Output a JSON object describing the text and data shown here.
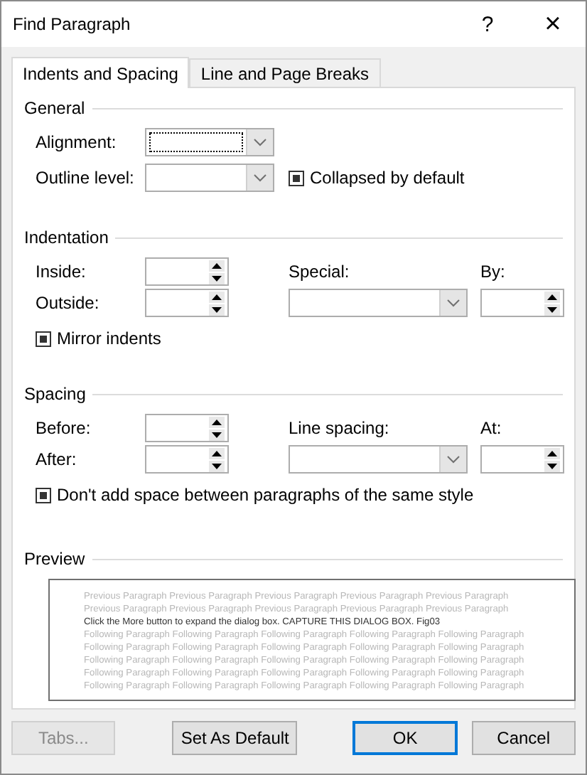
{
  "window": {
    "title": "Find Paragraph",
    "help": "?",
    "close": "×"
  },
  "tabs": [
    {
      "label": "Indents and Spacing",
      "selected": true
    },
    {
      "label": "Line and Page Breaks",
      "selected": false
    }
  ],
  "general": {
    "title": "General",
    "alignment": {
      "label": "Alignment:",
      "focused": true
    },
    "outline_level": {
      "label": "Outline level:"
    },
    "collapsed": {
      "label": "Collapsed by default",
      "indeterminate": true
    }
  },
  "indentation": {
    "title": "Indentation",
    "inside": "Inside:",
    "outside": "Outside:",
    "special": "Special:",
    "by": "By:",
    "mirror": {
      "label": "Mirror indents",
      "indeterminate": true
    }
  },
  "spacing": {
    "title": "Spacing",
    "before": "Before:",
    "after": "After:",
    "line_spacing": "Line spacing:",
    "at": "At:",
    "dont_add": {
      "label": "Don't add space between paragraphs of the same style",
      "indeterminate": true
    }
  },
  "preview": {
    "title": "Preview",
    "lines": [
      {
        "kind": "context",
        "text": "Previous Paragraph Previous Paragraph Previous Paragraph Previous Paragraph Previous Paragraph"
      },
      {
        "kind": "context",
        "text": "Previous Paragraph Previous Paragraph Previous Paragraph Previous Paragraph Previous Paragraph"
      },
      {
        "kind": "sample",
        "text": "Click the More button to expand the dialog box. CAPTURE THIS DIALOG BOX. Fig03"
      },
      {
        "kind": "context",
        "text": "Following Paragraph Following Paragraph Following Paragraph Following Paragraph Following Paragraph"
      },
      {
        "kind": "context",
        "text": "Following Paragraph Following Paragraph Following Paragraph Following Paragraph Following Paragraph"
      },
      {
        "kind": "context",
        "text": "Following Paragraph Following Paragraph Following Paragraph Following Paragraph Following Paragraph"
      },
      {
        "kind": "context",
        "text": "Following Paragraph Following Paragraph Following Paragraph Following Paragraph Following Paragraph"
      },
      {
        "kind": "context",
        "text": "Following Paragraph Following Paragraph Following Paragraph Following Paragraph Following Paragraph"
      }
    ]
  },
  "buttons": [
    {
      "label": "Tabs...",
      "disabled": true,
      "default": false
    },
    {
      "label": "Set As Default",
      "disabled": false,
      "default": false
    },
    {
      "label": "OK",
      "disabled": false,
      "default": true
    },
    {
      "label": "Cancel",
      "disabled": false,
      "default": false
    }
  ]
}
